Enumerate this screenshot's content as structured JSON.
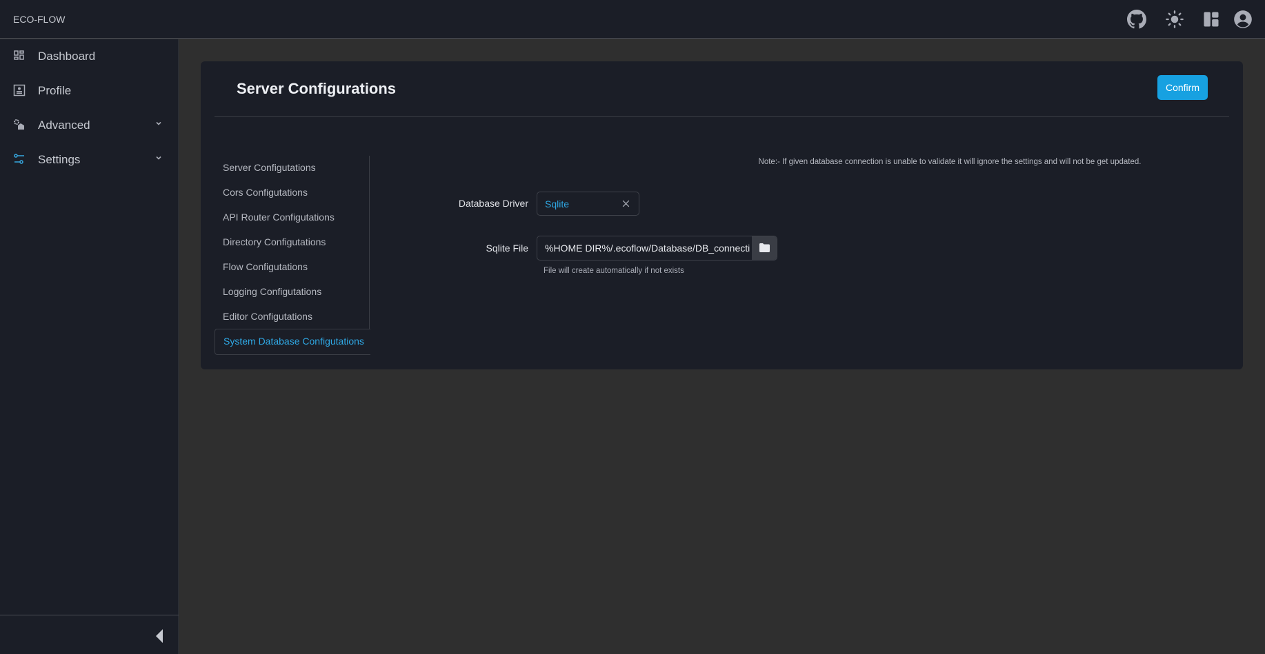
{
  "header": {
    "brand": "ECO-FLOW",
    "icons": [
      "github-icon",
      "sun-icon",
      "layout-icon",
      "user-avatar-icon"
    ]
  },
  "sidebar": {
    "items": [
      {
        "label": "Dashboard",
        "icon": "dashboard-icon"
      },
      {
        "label": "Profile",
        "icon": "profile-icon"
      },
      {
        "label": "Advanced",
        "icon": "advanced-icon",
        "expandable": true
      },
      {
        "label": "Settings",
        "icon": "settings-sliders-icon",
        "expandable": true,
        "active_icon_color": "#36a9e1"
      }
    ]
  },
  "card": {
    "title": "Server Configurations",
    "confirm_label": "Confirm",
    "subnav": [
      "Server Configutations",
      "Cors Configutations",
      "API Router Configutations",
      "Directory Configutations",
      "Flow Configutations",
      "Logging Configutations",
      "Editor Configutations",
      "System Database Configutations"
    ],
    "active_subnav": "System Database Configutations",
    "note": "Note:- If given database connection is unable to validate it will ignore the settings and will not be get updated.",
    "driver_label": "Database Driver",
    "driver_value": "Sqlite",
    "file_label": "Sqlite File",
    "file_value": "%HOME DIR%/.ecoflow/Database/DB_connecti",
    "file_help": "File will create automatically if not exists"
  },
  "colors": {
    "accent": "#17a1e1",
    "background": "#2f2f2f",
    "panel": "#1b1e27"
  }
}
